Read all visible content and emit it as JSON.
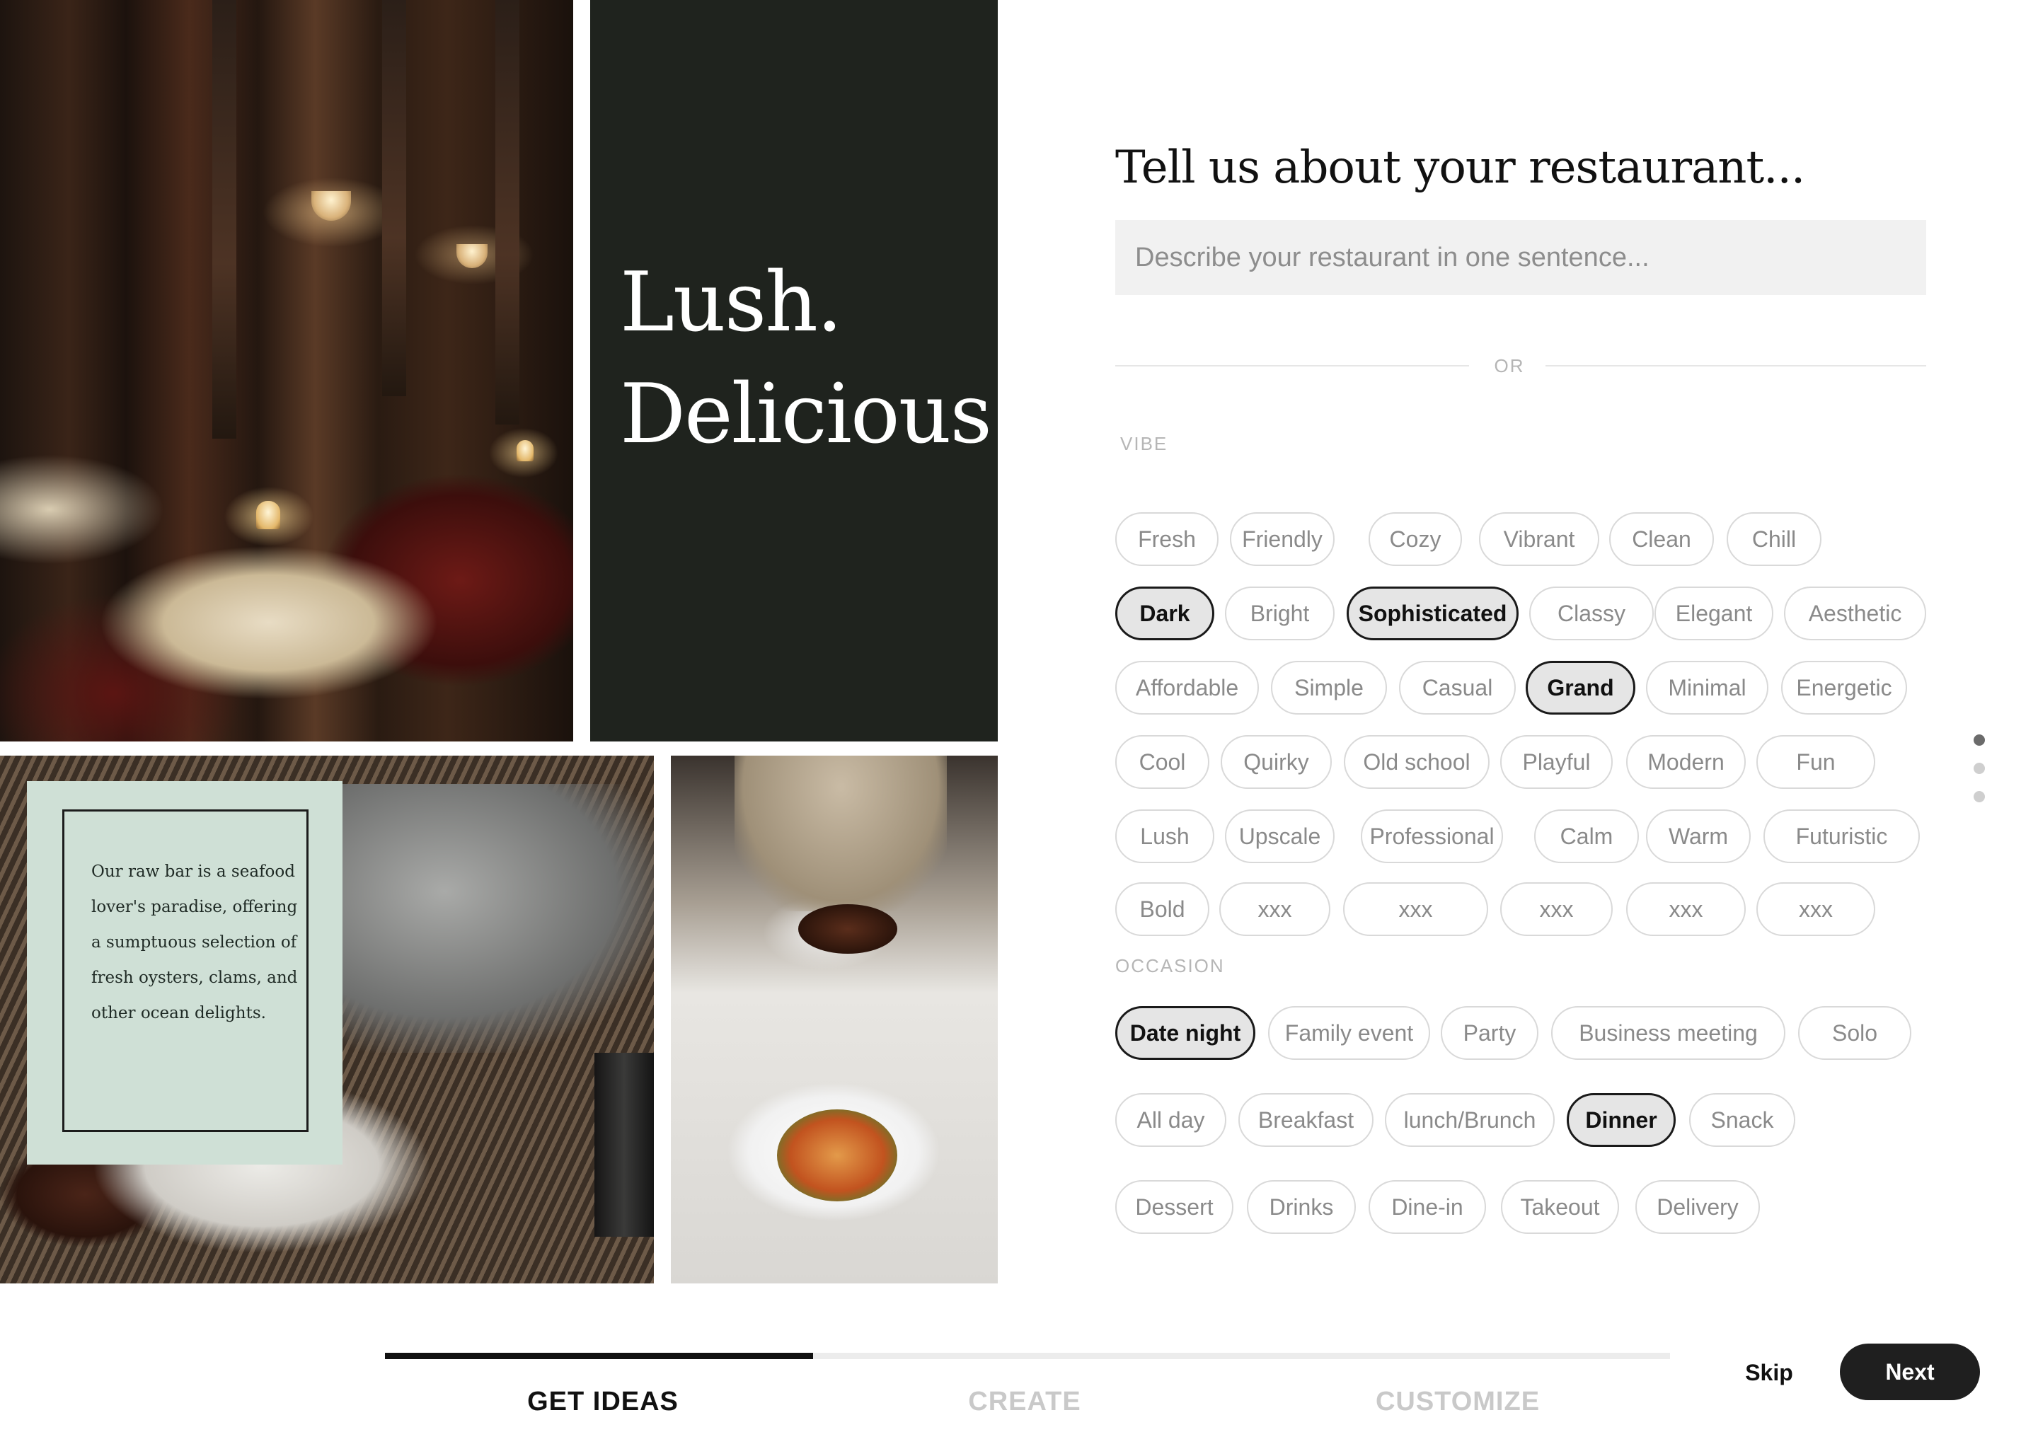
{
  "hero": {
    "line1": "Lush.",
    "line2": "Delicious."
  },
  "quote": {
    "text": "Our raw bar is a seafood lover's paradise, offering a sumptuous selection of fresh oysters, clams, and other ocean delights."
  },
  "form": {
    "title": "Tell us about your restaurant...",
    "describe_placeholder": "Describe your restaurant in one sentence...",
    "describe_value": "",
    "or_label": "OR",
    "vibe_label": "VIBE",
    "occasion_label": "OCCASION"
  },
  "vibe": [
    [
      {
        "label": "Fresh",
        "selected": false
      },
      {
        "label": "Friendly",
        "selected": false
      },
      {
        "label": "Cozy",
        "selected": false
      },
      {
        "label": "Vibrant",
        "selected": false
      },
      {
        "label": "Clean",
        "selected": false
      },
      {
        "label": "Chill",
        "selected": false
      }
    ],
    [
      {
        "label": "Dark",
        "selected": true
      },
      {
        "label": "Bright",
        "selected": false
      },
      {
        "label": "Sophisticated",
        "selected": true
      },
      {
        "label": "Classy",
        "selected": false
      },
      {
        "label": "Elegant",
        "selected": false
      },
      {
        "label": "Aesthetic",
        "selected": false
      }
    ],
    [
      {
        "label": "Affordable",
        "selected": false
      },
      {
        "label": "Simple",
        "selected": false
      },
      {
        "label": "Casual",
        "selected": false
      },
      {
        "label": "Grand",
        "selected": true
      },
      {
        "label": "Minimal",
        "selected": false
      },
      {
        "label": "Energetic",
        "selected": false
      }
    ],
    [
      {
        "label": "Cool",
        "selected": false
      },
      {
        "label": "Quirky",
        "selected": false
      },
      {
        "label": "Old school",
        "selected": false
      },
      {
        "label": "Playful",
        "selected": false
      },
      {
        "label": "Modern",
        "selected": false
      },
      {
        "label": "Fun",
        "selected": false
      }
    ],
    [
      {
        "label": "Lush",
        "selected": false
      },
      {
        "label": "Upscale",
        "selected": false
      },
      {
        "label": "Professional",
        "selected": false
      },
      {
        "label": "Calm",
        "selected": false
      },
      {
        "label": "Warm",
        "selected": false
      },
      {
        "label": "Futuristic",
        "selected": false
      }
    ],
    [
      {
        "label": "Bold",
        "selected": false
      },
      {
        "label": "xxx",
        "selected": false
      },
      {
        "label": "xxx",
        "selected": false
      },
      {
        "label": "xxx",
        "selected": false
      },
      {
        "label": "xxx",
        "selected": false
      },
      {
        "label": "xxx",
        "selected": false
      }
    ]
  ],
  "occasion": [
    [
      {
        "label": "Date night",
        "selected": true
      },
      {
        "label": "Family event",
        "selected": false
      },
      {
        "label": "Party",
        "selected": false
      },
      {
        "label": "Business meeting",
        "selected": false
      },
      {
        "label": "Solo",
        "selected": false
      }
    ],
    [
      {
        "label": "All day",
        "selected": false
      },
      {
        "label": "Breakfast",
        "selected": false
      },
      {
        "label": "lunch/Brunch",
        "selected": false
      },
      {
        "label": "Dinner",
        "selected": true
      },
      {
        "label": "Snack",
        "selected": false
      }
    ],
    [
      {
        "label": "Dessert",
        "selected": false
      },
      {
        "label": "Drinks",
        "selected": false
      },
      {
        "label": "Dine-in",
        "selected": false
      },
      {
        "label": "Takeout",
        "selected": false
      },
      {
        "label": "Delivery",
        "selected": false
      }
    ]
  ],
  "pagination": {
    "total": 3,
    "active": 0
  },
  "footer": {
    "steps": [
      {
        "label": "GET IDEAS",
        "active": true
      },
      {
        "label": "CREATE",
        "active": false
      },
      {
        "label": "CUSTOMIZE",
        "active": false
      }
    ],
    "progress": 0.333,
    "skip_label": "Skip",
    "next_label": "Next"
  },
  "colors": {
    "accent": "#1f1f1f",
    "panel": "#1f231e",
    "card": "#cfe0d6"
  }
}
